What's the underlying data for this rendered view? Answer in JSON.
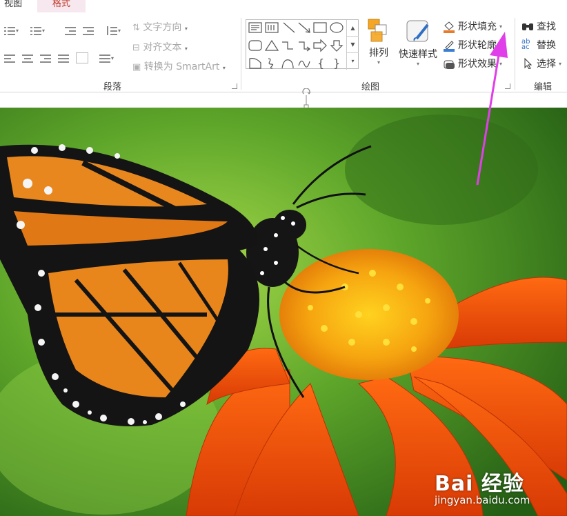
{
  "tabs": {
    "view": "视图",
    "format": "格式"
  },
  "groups": {
    "paragraph": "段落",
    "drawing": "绘图",
    "editing": "编辑"
  },
  "paragraph": {
    "text_direction": "文字方向",
    "align_text": "对齐文本",
    "convert_smartart": "转换为 SmartArt"
  },
  "drawing": {
    "arrange": "排列",
    "quick_styles": "快速样式",
    "shape_fill": "形状填充",
    "shape_outline": "形状轮廓",
    "shape_effects": "形状效果"
  },
  "editing": {
    "find": "查找",
    "replace": "替换",
    "select": "选择"
  },
  "watermark": {
    "logo": "Bai  经验",
    "url": "jingyan.baidu.com"
  },
  "colors": {
    "tab_active_bg": "#f7e7ef",
    "tab_active_text": "#c0392b",
    "annotation_arrow": "#e03ee8",
    "fill_bar": "#e97a2a",
    "outline_bar": "#3a7dd4"
  },
  "icons": [
    "bullets-icon",
    "numbering-icon",
    "decrease-indent-icon",
    "increase-indent-icon",
    "line-spacing-icon",
    "text-direction-icon",
    "align-text-icon",
    "smartart-icon",
    "arrange-icon",
    "quick-styles-icon",
    "paint-bucket-icon",
    "pencil-icon",
    "effects-icon",
    "binoculars-icon",
    "replace-icon",
    "cursor-icon"
  ]
}
